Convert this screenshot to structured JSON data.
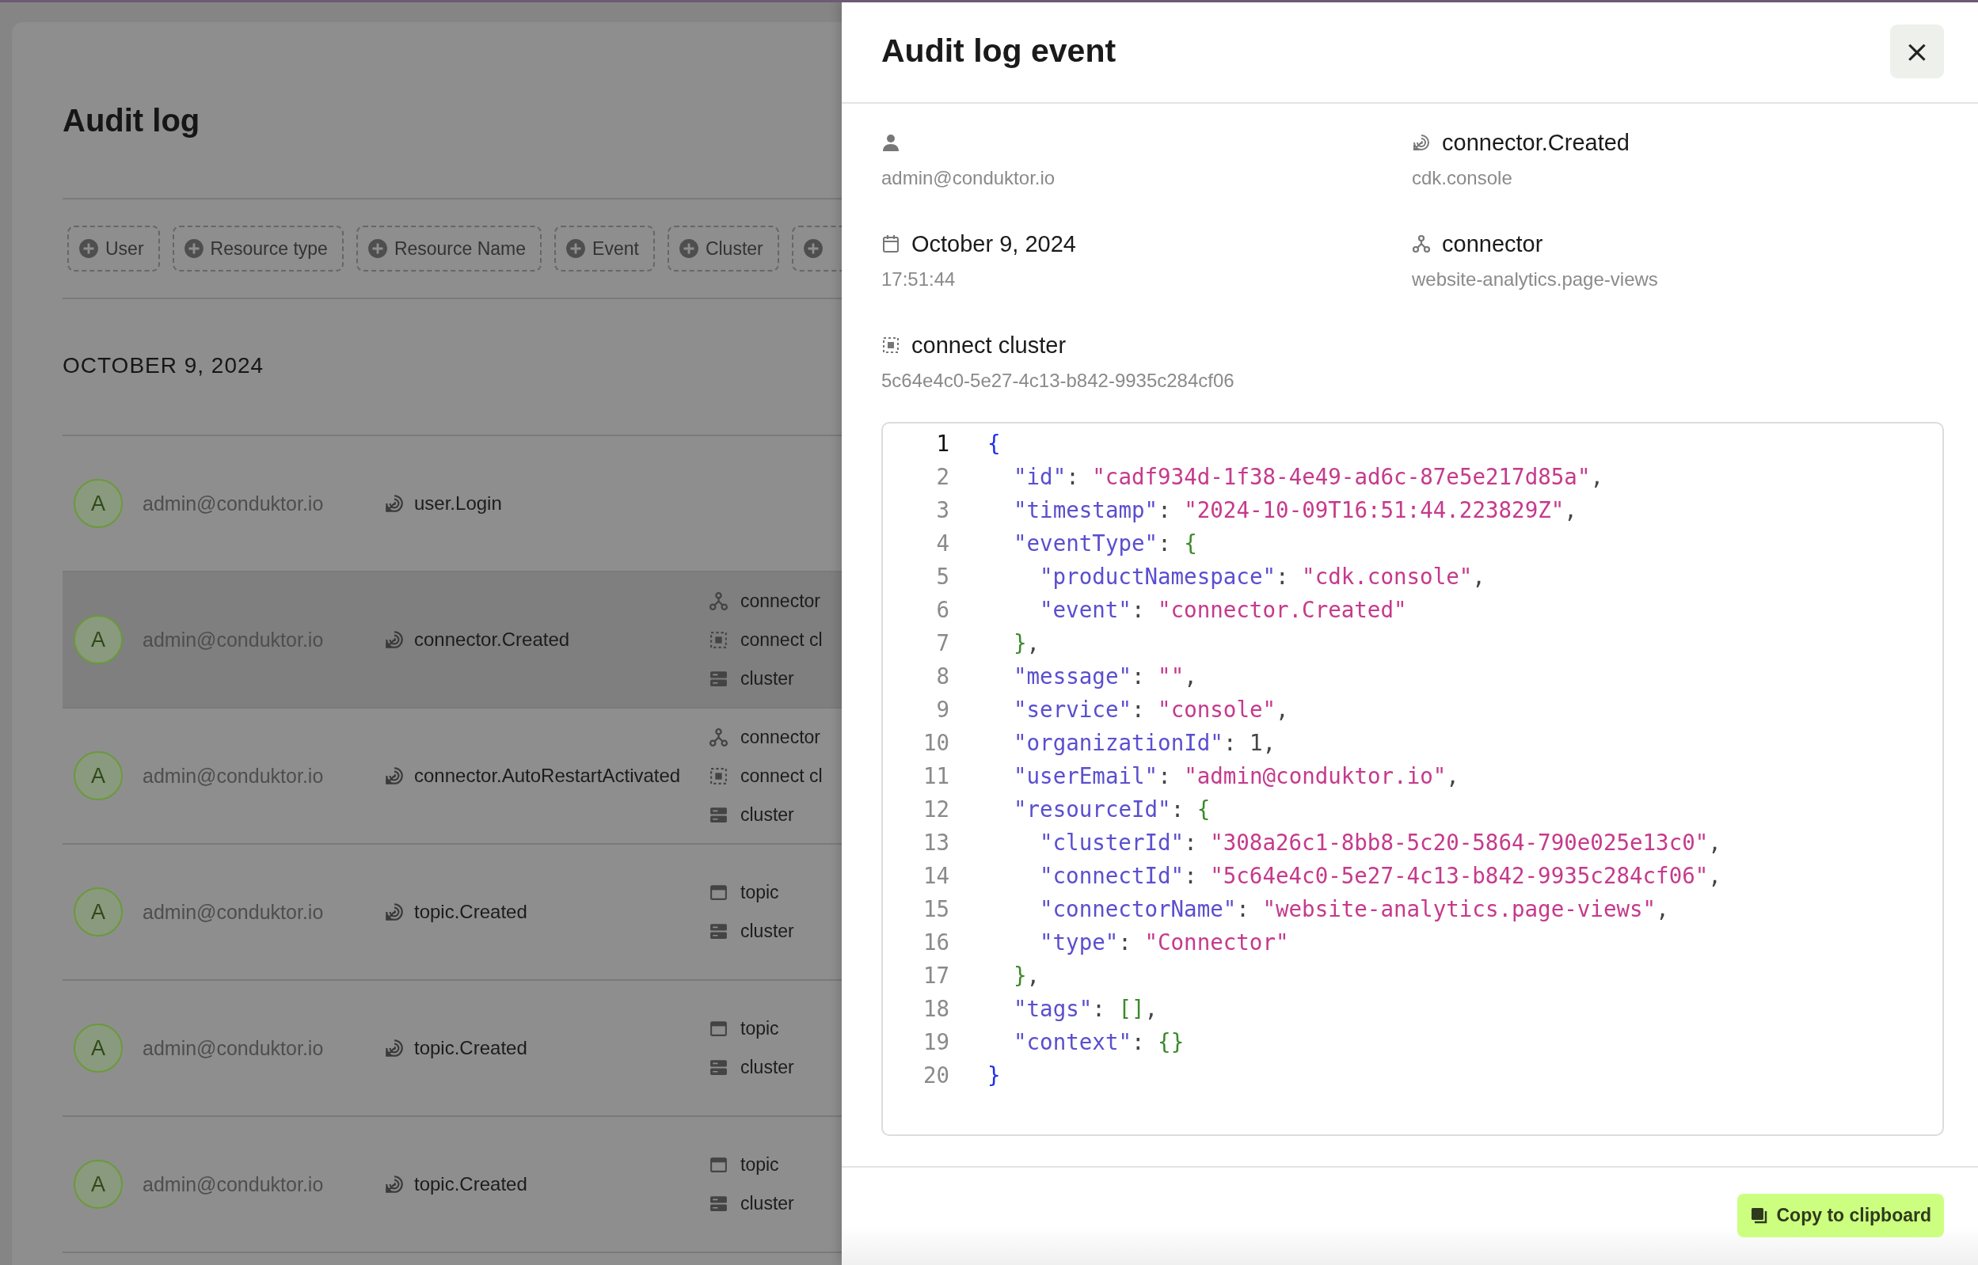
{
  "page": {
    "title": "Audit log",
    "filters": [
      {
        "kind": "labeled",
        "label": "User"
      },
      {
        "kind": "labeled",
        "label": "Resource type"
      },
      {
        "kind": "labeled",
        "label": "Resource Name"
      },
      {
        "kind": "labeled",
        "label": "Event"
      },
      {
        "kind": "labeled",
        "label": "Cluster"
      },
      {
        "kind": "cut"
      }
    ],
    "date_heading": "OCTOBER 9, 2024",
    "rows": [
      {
        "avatar": "A",
        "user": "admin@conduktor.io",
        "event": "user.Login",
        "selected": false,
        "resources": []
      },
      {
        "avatar": "A",
        "user": "admin@conduktor.io",
        "event": "connector.Created",
        "selected": true,
        "resources": [
          {
            "kind": "connector",
            "label": "connector"
          },
          {
            "kind": "connect-cluster",
            "label": "connect cl"
          },
          {
            "kind": "cluster",
            "label": "cluster"
          }
        ]
      },
      {
        "avatar": "A",
        "user": "admin@conduktor.io",
        "event": "connector.AutoRestartActivated",
        "selected": false,
        "resources": [
          {
            "kind": "connector",
            "label": "connector"
          },
          {
            "kind": "connect-cluster",
            "label": "connect cl"
          },
          {
            "kind": "cluster",
            "label": "cluster"
          }
        ]
      },
      {
        "avatar": "A",
        "user": "admin@conduktor.io",
        "event": "topic.Created",
        "selected": false,
        "resources": [
          {
            "kind": "topic",
            "label": "topic"
          },
          {
            "kind": "cluster",
            "label": "cluster"
          }
        ]
      },
      {
        "avatar": "A",
        "user": "admin@conduktor.io",
        "event": "topic.Created",
        "selected": false,
        "resources": [
          {
            "kind": "topic",
            "label": "topic"
          },
          {
            "kind": "cluster",
            "label": "cluster"
          }
        ]
      },
      {
        "avatar": "A",
        "user": "admin@conduktor.io",
        "event": "topic.Created",
        "selected": false,
        "resources": [
          {
            "kind": "topic",
            "label": "topic"
          },
          {
            "kind": "cluster",
            "label": "cluster"
          }
        ]
      }
    ]
  },
  "drawer": {
    "title": "Audit log event",
    "close": "×",
    "details": [
      {
        "kind": "user",
        "sub": "admin@conduktor.io"
      },
      {
        "kind": "date",
        "label": "October 9, 2024",
        "sub": "17:51:44"
      },
      {
        "kind": "connect-cluster",
        "label": "connect cluster",
        "sub": "5c64e4c0-5e27-4c13-b842-9935c284cf06"
      },
      {
        "kind": "event",
        "label": "connector.Created",
        "sub": "cdk.console"
      },
      {
        "kind": "connector",
        "label": "connector",
        "sub": "website-analytics.page-views"
      }
    ],
    "code_lines": [
      {
        "number": "1",
        "selected": true,
        "tokens": [
          {
            "kind": "brace",
            "text": "{"
          }
        ],
        "children": [
          {
            "number": "2",
            "selected": false,
            "tokens": [
              {
                "kind": "key",
                "text": "\"id\""
              },
              {
                "kind": "punct",
                "text": ":"
              },
              {
                "kind": "string",
                "text": "\"cadf934d-1f38-4e49-ad6c-87e5e217d85a\""
              },
              {
                "kind": "punct",
                "text": ","
              }
            ]
          },
          {
            "number": "3",
            "selected": false,
            "tokens": [
              {
                "kind": "key",
                "text": "\"timestamp\""
              },
              {
                "kind": "punct",
                "text": ":"
              },
              {
                "kind": "string",
                "text": "\"2024-10-09T16:51:44.223829Z\""
              },
              {
                "kind": "punct",
                "text": ","
              }
            ]
          },
          {
            "number": "4",
            "selected": false,
            "tokens": [
              {
                "kind": "key",
                "text": "\"eventType\""
              },
              {
                "kind": "punct",
                "text": ":"
              },
              {
                "kind": "nested",
                "text": "{"
              }
            ],
            "children": [
              {
                "number": "5",
                "selected": false,
                "tokens": [
                  {
                    "kind": "key",
                    "text": "\"productNamespace\""
                  },
                  {
                    "kind": "punct",
                    "text": ":"
                  },
                  {
                    "kind": "string",
                    "text": "\"cdk.console\""
                  },
                  {
                    "kind": "punct",
                    "text": ","
                  }
                ]
              },
              {
                "number": "6",
                "selected": false,
                "tokens": [
                  {
                    "kind": "key",
                    "text": "\"event\""
                  },
                  {
                    "kind": "punct",
                    "text": ":"
                  },
                  {
                    "kind": "string",
                    "text": "\"connector.Created\""
                  }
                ]
              }
            ]
          },
          {
            "number": "7",
            "selected": false,
            "tokens": [
              {
                "kind": "nested",
                "text": "}"
              },
              {
                "kind": "punct",
                "text": ","
              }
            ]
          },
          {
            "number": "8",
            "selected": false,
            "tokens": [
              {
                "kind": "key",
                "text": "\"message\""
              },
              {
                "kind": "punct",
                "text": ":"
              },
              {
                "kind": "string",
                "text": "\"\""
              },
              {
                "kind": "punct",
                "text": ","
              }
            ]
          },
          {
            "number": "9",
            "selected": false,
            "tokens": [
              {
                "kind": "key",
                "text": "\"service\""
              },
              {
                "kind": "punct",
                "text": ":"
              },
              {
                "kind": "string",
                "text": "\"console\""
              },
              {
                "kind": "punct",
                "text": ","
              }
            ]
          },
          {
            "number": "10",
            "selected": false,
            "tokens": [
              {
                "kind": "key",
                "text": "\"organizationId\""
              },
              {
                "kind": "punct",
                "text": ":"
              },
              {
                "kind": "number",
                "text": "1"
              },
              {
                "kind": "punct",
                "text": ","
              }
            ]
          },
          {
            "number": "11",
            "selected": false,
            "tokens": [
              {
                "kind": "key",
                "text": "\"userEmail\""
              },
              {
                "kind": "punct",
                "text": ":"
              },
              {
                "kind": "string",
                "text": "\"admin@conduktor.io\""
              },
              {
                "kind": "punct",
                "text": ","
              }
            ]
          },
          {
            "number": "12",
            "selected": false,
            "tokens": [
              {
                "kind": "key",
                "text": "\"resourceId\""
              },
              {
                "kind": "punct",
                "text": ":"
              },
              {
                "kind": "nested",
                "text": "{"
              }
            ],
            "children": [
              {
                "number": "13",
                "selected": false,
                "tokens": [
                  {
                    "kind": "key",
                    "text": "\"clusterId\""
                  },
                  {
                    "kind": "punct",
                    "text": ":"
                  },
                  {
                    "kind": "string",
                    "text": "\"308a26c1-8bb8-5c20-5864-790e025e13c0\""
                  },
                  {
                    "kind": "punct",
                    "text": ","
                  }
                ]
              },
              {
                "number": "14",
                "selected": false,
                "tokens": [
                  {
                    "kind": "key",
                    "text": "\"connectId\""
                  },
                  {
                    "kind": "punct",
                    "text": ":"
                  },
                  {
                    "kind": "string",
                    "text": "\"5c64e4c0-5e27-4c13-b842-9935c284cf06\""
                  },
                  {
                    "kind": "punct",
                    "text": ","
                  }
                ]
              },
              {
                "number": "15",
                "selected": false,
                "tokens": [
                  {
                    "kind": "key",
                    "text": "\"connectorName\""
                  },
                  {
                    "kind": "punct",
                    "text": ":"
                  },
                  {
                    "kind": "string",
                    "text": "\"website-analytics.page-views\""
                  },
                  {
                    "kind": "punct",
                    "text": ","
                  }
                ]
              },
              {
                "number": "16",
                "selected": false,
                "tokens": [
                  {
                    "kind": "key",
                    "text": "\"type\""
                  },
                  {
                    "kind": "punct",
                    "text": ":"
                  },
                  {
                    "kind": "string",
                    "text": "\"Connector\""
                  }
                ]
              }
            ]
          },
          {
            "number": "17",
            "selected": false,
            "tokens": [
              {
                "kind": "nested",
                "text": "}"
              },
              {
                "kind": "punct",
                "text": ","
              }
            ]
          },
          {
            "number": "18",
            "selected": false,
            "tokens": [
              {
                "kind": "key",
                "text": "\"tags\""
              },
              {
                "kind": "punct",
                "text": ":"
              },
              {
                "kind": "nested",
                "text": "[]"
              },
              {
                "kind": "punct",
                "text": ","
              }
            ]
          },
          {
            "number": "19",
            "selected": false,
            "tokens": [
              {
                "kind": "key",
                "text": "\"context\""
              },
              {
                "kind": "punct",
                "text": ":"
              },
              {
                "kind": "nested",
                "text": "{}"
              }
            ]
          }
        ]
      },
      {
        "number": "20",
        "selected": false,
        "tokens": [
          {
            "kind": "brace",
            "text": "}"
          }
        ]
      }
    ],
    "copy_button": "Copy to clipboard"
  }
}
